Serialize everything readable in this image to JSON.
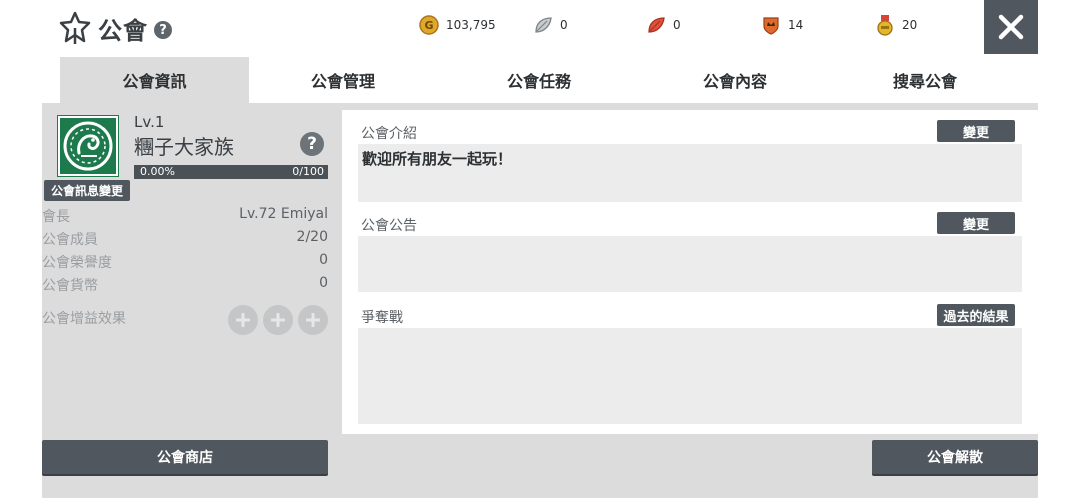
{
  "header": {
    "title": "公會",
    "help": "?"
  },
  "currencies": [
    {
      "name": "gold",
      "icon": "gold-coin-icon",
      "value": "103,795",
      "color": "#e0a82a"
    },
    {
      "name": "silver-feather",
      "icon": "silver-leaf-icon",
      "value": "0",
      "color": "#a9adb0"
    },
    {
      "name": "red-feather",
      "icon": "red-leaf-icon",
      "value": "0",
      "color": "#e2513c"
    },
    {
      "name": "crown-badge",
      "icon": "crown-shield-icon",
      "value": "14",
      "color": "#e06a2c"
    },
    {
      "name": "medal",
      "icon": "medal-icon",
      "value": "20",
      "color": "#e7b52a"
    }
  ],
  "tabs": [
    {
      "label": "公會資訊",
      "active": true
    },
    {
      "label": "公會管理",
      "active": false
    },
    {
      "label": "公會任務",
      "active": false
    },
    {
      "label": "公會內容",
      "active": false
    },
    {
      "label": "搜尋公會",
      "active": false
    }
  ],
  "guild": {
    "level": "Lv.1",
    "name": "糰子大家族",
    "help": "?",
    "exp_percent": "0.00%",
    "exp_value": "0/100",
    "exp_fraction": 0,
    "info_change_label": "公會訊息變更",
    "stats": [
      {
        "key": "會長",
        "value": "Lv.72 Emiyal"
      },
      {
        "key": "公會成員",
        "value": "2/20"
      },
      {
        "key": "公會榮譽度",
        "value": "0"
      },
      {
        "key": "公會貨幣",
        "value": "0"
      }
    ],
    "buff_label": "公會增益效果",
    "buff_slots": 3
  },
  "sections": {
    "intro": {
      "label": "公會介紹",
      "button": "變更",
      "text": "歡迎所有朋友一起玩！"
    },
    "notice": {
      "label": "公會公告",
      "button": "變更",
      "text": ""
    },
    "war": {
      "label": "爭奪戰",
      "button": "過去的結果",
      "text": ""
    }
  },
  "bottom": {
    "shop_label": "公會商店",
    "disband_label": "公會解散"
  },
  "colors": {
    "accent_dark": "#50575e",
    "background": "#dcdcdc",
    "guild_logo": "#1d7a4d"
  }
}
